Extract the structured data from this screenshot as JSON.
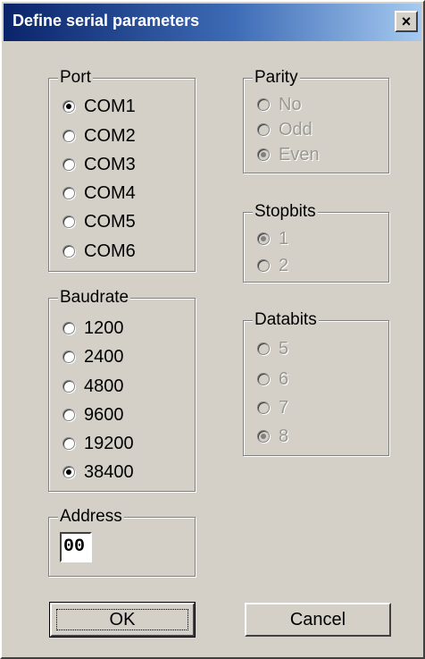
{
  "window": {
    "title": "Define serial parameters",
    "close_label": "×"
  },
  "port": {
    "label": "Port",
    "options": [
      "COM1",
      "COM2",
      "COM3",
      "COM4",
      "COM5",
      "COM6"
    ],
    "selected": "COM1"
  },
  "baudrate": {
    "label": "Baudrate",
    "options": [
      "1200",
      "2400",
      "4800",
      "9600",
      "19200",
      "38400"
    ],
    "selected": "38400"
  },
  "address": {
    "label": "Address",
    "value": "00"
  },
  "parity": {
    "label": "Parity",
    "options": [
      "No",
      "Odd",
      "Even"
    ],
    "selected": "Even",
    "enabled": false
  },
  "stopbits": {
    "label": "Stopbits",
    "options": [
      "1",
      "2"
    ],
    "selected": "1",
    "enabled": false
  },
  "databits": {
    "label": "Databits",
    "options": [
      "5",
      "6",
      "7",
      "8"
    ],
    "selected": "8",
    "enabled": false
  },
  "buttons": {
    "ok": "OK",
    "cancel": "Cancel"
  }
}
